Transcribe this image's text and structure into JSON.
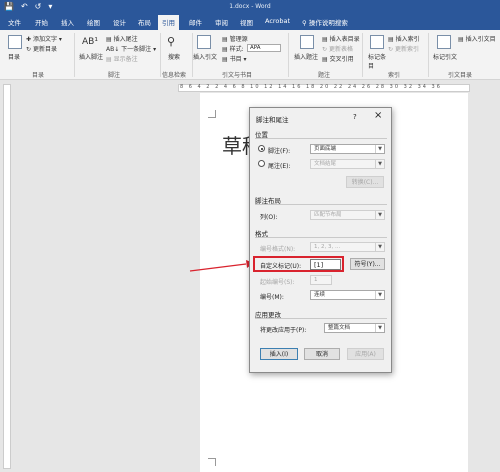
{
  "titlebar": {
    "title": "1.docx - Word",
    "qat": [
      "save-icon",
      "undo-icon",
      "redo-icon",
      "customize-icon"
    ]
  },
  "tabs": [
    "文件",
    "开始",
    "插入",
    "绘图",
    "设计",
    "布局",
    "引用",
    "邮件",
    "审阅",
    "视图",
    "Acrobat",
    "操作说明搜索"
  ],
  "active_tab": "引用",
  "ribbon": {
    "toc": {
      "big": "目录",
      "add_text": "添加文字",
      "update": "更新目录",
      "group": "目录"
    },
    "footnotes": {
      "insert": "插入脚注",
      "insert_endnote": "插入尾注",
      "next_footnote": "下一条脚注",
      "show_notes": "显示备注",
      "group": "脚注"
    },
    "research": {
      "search": "搜索",
      "group": "信息检索"
    },
    "citations": {
      "insert": "插入引文",
      "manage": "管理源",
      "style_label": "样式:",
      "style_value": "APA",
      "bibliography": "书目",
      "group": "引文与书目"
    },
    "captions": {
      "insert": "插入题注",
      "table_of_figures": "插入表目录",
      "update_table": "更新表格",
      "cross_ref": "交叉引用",
      "group": "题注"
    },
    "index": {
      "mark": "标记条目",
      "insert": "插入索引",
      "update": "更新索引",
      "group": "索引"
    },
    "toa": {
      "mark": "标记引文",
      "insert": "插入引文目",
      "group": "引文目录"
    }
  },
  "ruler": {
    "numbers": "8 6 4 2 2 4 6 8 10 12 14 16 18 20 22 24 26 28 30 32 34 36"
  },
  "document": {
    "heading": "草稿"
  },
  "dialog": {
    "title": "脚注和尾注",
    "help": "?",
    "close": "×",
    "location": {
      "section": "位置",
      "footnote_label": "脚注(F):",
      "footnote_value": "页面底端",
      "endnote_label": "尾注(E):",
      "endnote_value": "文档结尾",
      "convert": "转换(C)..."
    },
    "layout": {
      "section": "脚注布局",
      "columns_label": "列(O):",
      "columns_value": "匹配节布局"
    },
    "format": {
      "section": "格式",
      "number_format_label": "编号格式(N):",
      "number_format_value": "1, 2, 3, ...",
      "custom_mark_label": "自定义标记(U):",
      "custom_mark_value": "[1]",
      "symbol_button": "符号(Y)...",
      "start_at_label": "起始编号(S):",
      "start_at_value": "1",
      "numbering_label": "编号(M):",
      "numbering_value": "连续"
    },
    "apply": {
      "section": "应用更改",
      "apply_to_label": "将更改应用于(P):",
      "apply_to_value": "整篇文档"
    },
    "buttons": {
      "insert": "插入(I)",
      "cancel": "取消",
      "apply": "应用(A)"
    }
  },
  "colors": {
    "titlebar": "#2b579a",
    "highlight": "#d9232e",
    "arrow": "#d9232e"
  }
}
